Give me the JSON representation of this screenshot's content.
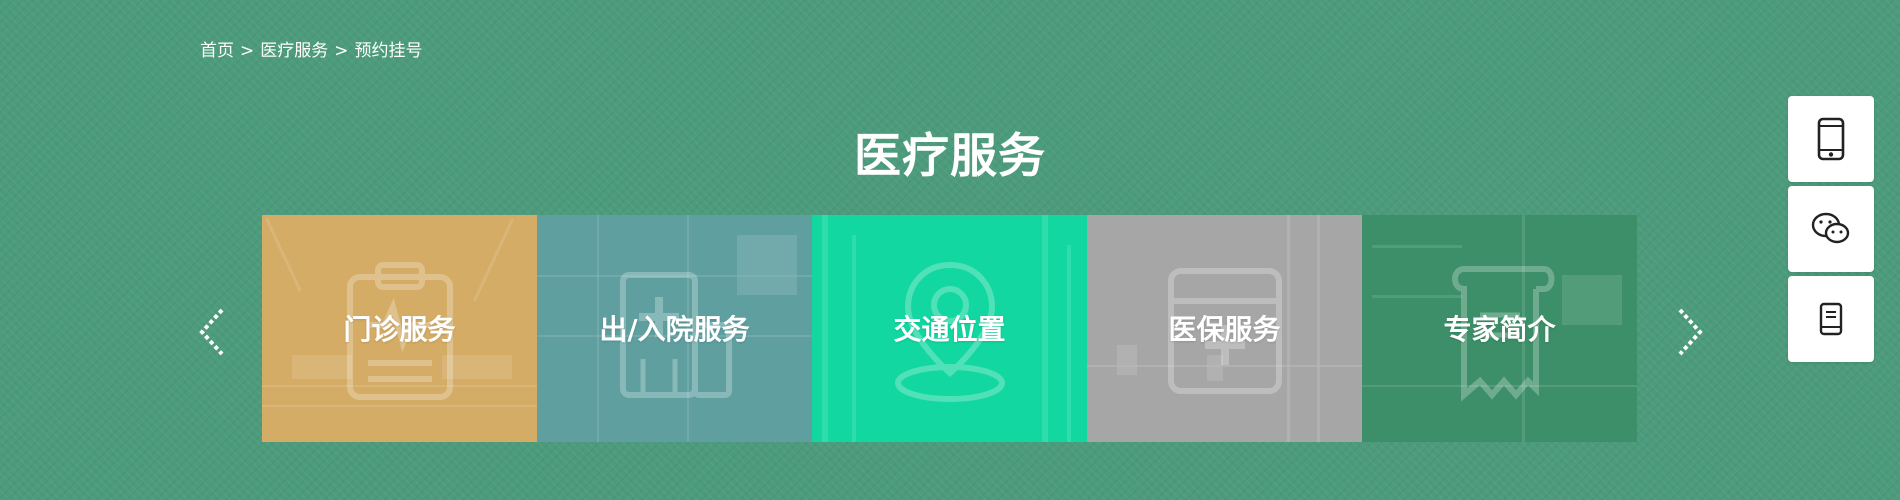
{
  "breadcrumb": {
    "home": "首页",
    "separator": ">",
    "section": "医疗服务",
    "current": "预约挂号"
  },
  "page_title": "医疗服务",
  "carousel": {
    "prev_icon": "chevron-left-icon",
    "next_icon": "chevron-right-icon",
    "cards": [
      {
        "label": "门诊服务",
        "icon": "clipboard-icon",
        "color": "#d4ac66"
      },
      {
        "label": "出/入院服务",
        "icon": "hospital-building-icon",
        "color": "#5f9fa0"
      },
      {
        "label": "交通位置",
        "icon": "location-pin-icon",
        "color": "#12d7a1"
      },
      {
        "label": "医保服务",
        "icon": "insurance-card-icon",
        "color": "#a6a6a6"
      },
      {
        "label": "专家简介",
        "icon": "certificate-scroll-icon",
        "color": "#3c8f68"
      }
    ]
  },
  "floating_toolbar": [
    {
      "icon": "mobile-phone-icon"
    },
    {
      "icon": "wechat-icon"
    },
    {
      "icon": "notebook-icon"
    }
  ],
  "colors": {
    "background": "#4c9b7c",
    "text": "#ffffff",
    "float_button_bg": "#ffffff",
    "float_icon": "#222222"
  }
}
